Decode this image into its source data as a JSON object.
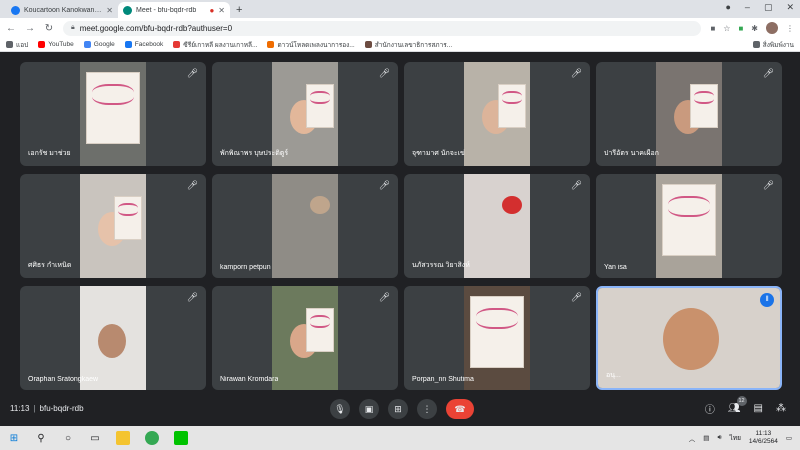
{
  "browser": {
    "tabs": [
      {
        "title": "Koucartoon Kanokwan Zaa | Face",
        "favicon_color": "#1877f2",
        "active": false
      },
      {
        "title": "Meet - bfu-bqdr-rdb",
        "favicon_color": "#00897b",
        "active": true
      }
    ],
    "new_tab_icon": "plus-icon",
    "url": "meet.google.com/bfu-bqdr-rdb?authuser=0",
    "bookmarks": [
      {
        "label": "แอป",
        "color": "#5f6368"
      },
      {
        "label": "YouTube",
        "color": "#ff0000"
      },
      {
        "label": "Google",
        "color": "#4285f4"
      },
      {
        "label": "Facebook",
        "color": "#1877f2"
      },
      {
        "label": "ซีรีย์เกาหลี ผลงานเกาหลี...",
        "color": "#e53935"
      },
      {
        "label": "ดาวน์โหลดเพลงนาการอง...",
        "color": "#ef6c00"
      },
      {
        "label": "สำนักงานเลขาธิการสภาร...",
        "color": "#6d4c41"
      }
    ],
    "bookmarks_right": "สิ่งพิมพ์งาน"
  },
  "participants": [
    {
      "name": "เอกรัช มาช่วย",
      "bg": "#6d6f6b",
      "skin": "#eceae4",
      "paper": true,
      "face": false
    },
    {
      "name": "พักพิณาพร บุษประติตูร์",
      "bg": "#9c9a95",
      "skin": "#e2b79a",
      "paper": true,
      "face": true
    },
    {
      "name": "จุฑามาศ นักจะเข่",
      "bg": "#b8b2a8",
      "skin": "#dcb49a",
      "paper": true,
      "face": true
    },
    {
      "name": "ปารีอัตร นาคเผือก",
      "bg": "#7a7470",
      "skin": "#c99a7e",
      "paper": true,
      "face": true
    },
    {
      "name": "ศศิธร กำเหนิด",
      "bg": "#c9c4be",
      "skin": "#e6c2aa",
      "paper": true,
      "face": true
    },
    {
      "name": "kamporn petpun",
      "bg": "#8f8c86",
      "skin": "#bfa58c",
      "paper": false,
      "face": false
    },
    {
      "name": "นภัสวรรณ วิยาสิงห์",
      "bg": "#d8d2cf",
      "skin": "#d32f2f",
      "paper": false,
      "face": false
    },
    {
      "name": "Yan isa",
      "bg": "#a9a39a",
      "skin": "#d7b7a0",
      "paper": true,
      "face": false
    },
    {
      "name": "Oraphan Sratongkaew",
      "bg": "#e4e2df",
      "skin": "#b88a6f",
      "paper": false,
      "face": true
    },
    {
      "name": "Nirawan Kromdara",
      "bg": "#6c7a5d",
      "skin": "#d9a78a",
      "paper": true,
      "face": true
    },
    {
      "name": "Porpan_nn Shutima",
      "bg": "#5b4b40",
      "skin": "#ddc9b7",
      "paper": true,
      "face": false
    },
    {
      "name": "อนุ...",
      "bg": "#d7d1cb",
      "skin": "#c9916c",
      "paper": false,
      "face": true,
      "speaking": true
    }
  ],
  "controls": {
    "time": "11:13",
    "meeting_code": "bfu-bqdr-rdb",
    "people_count": "12"
  },
  "taskbar": {
    "lang": "ไทย",
    "time": "11:13",
    "date": "14/6/2564"
  }
}
